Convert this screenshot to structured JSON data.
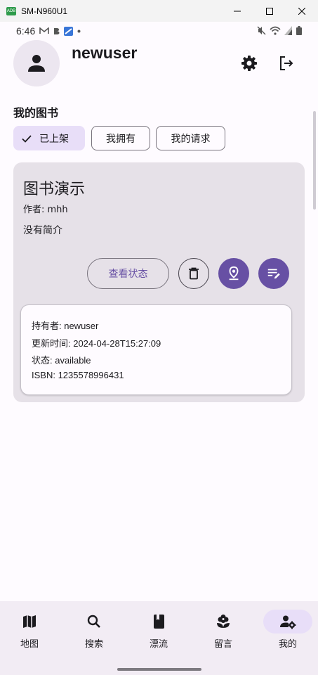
{
  "window": {
    "title": "SM-N960U1",
    "app_icon_text": "ADB"
  },
  "status_bar": {
    "time": "6:46"
  },
  "profile": {
    "username": "newuser"
  },
  "section": {
    "title": "我的图书"
  },
  "chips": [
    {
      "label": "已上架",
      "selected": true
    },
    {
      "label": "我拥有",
      "selected": false
    },
    {
      "label": "我的请求",
      "selected": false
    }
  ],
  "book": {
    "title": "图书演示",
    "author": "作者: mhh",
    "description": "没有简介",
    "status_button": "查看状态",
    "info": {
      "holder": "持有者: newuser",
      "updated": "更新时间: 2024-04-28T15:27:09",
      "state": "状态: available",
      "isbn": "ISBN: 1235578996431"
    }
  },
  "nav": [
    {
      "label": "地图",
      "icon": "map-icon",
      "active": false
    },
    {
      "label": "搜索",
      "icon": "search-icon",
      "active": false
    },
    {
      "label": "漂流",
      "icon": "book-icon",
      "active": false
    },
    {
      "label": "留言",
      "icon": "flower-icon",
      "active": false
    },
    {
      "label": "我的",
      "icon": "user-settings-icon",
      "active": true
    }
  ],
  "colors": {
    "primary": "#6750a4",
    "secondary_container": "#e8def8",
    "surface_variant": "#e6e1e8",
    "nav_background": "#f2ecf4"
  }
}
